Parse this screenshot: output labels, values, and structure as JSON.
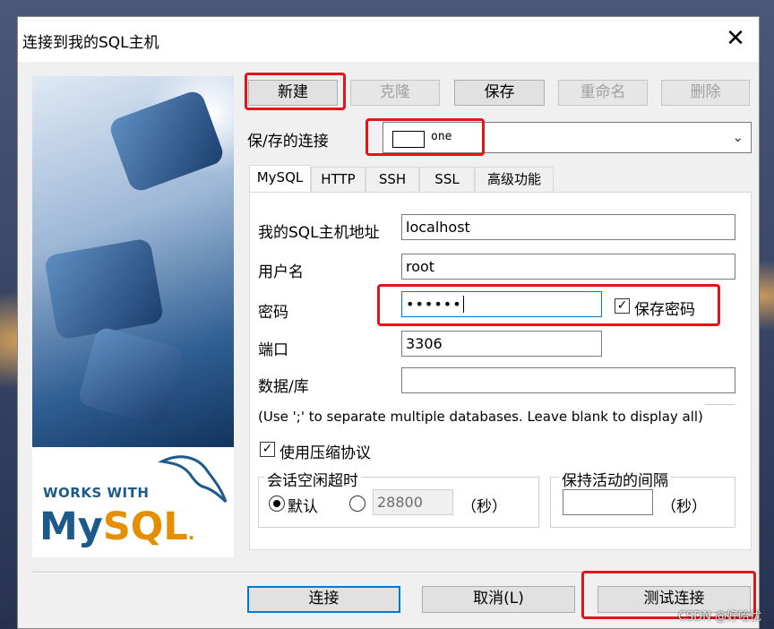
{
  "window": {
    "title": "连接到我的SQL主机",
    "close_label": "✕"
  },
  "toolbar": {
    "new_label": "新建",
    "clone_label": "克隆",
    "save_label": "保存",
    "rename_label": "重命名",
    "delete_label": "删除"
  },
  "saved_connections": {
    "label": "保/存的连接",
    "selected": "one",
    "swatch_color": "#ffffff"
  },
  "tabs": [
    "MySQL",
    "HTTP",
    "SSH",
    "SSL",
    "高级功能"
  ],
  "form": {
    "host_label": "我的SQL主机地址",
    "host_value": "localhost",
    "user_label": "用户名",
    "user_value": "root",
    "password_label": "密码",
    "password_value": "••••••",
    "save_password_label": "保存密码",
    "save_password_checked": true,
    "port_label": "端口",
    "port_value": "3306",
    "database_label": "数据/库",
    "database_value": "",
    "database_hint": "(Use ';' to separate multiple databases. Leave blank to display all)",
    "compress_label": "使用压缩协议",
    "compress_checked": true
  },
  "session_timeout": {
    "title": "会话空闲超时",
    "default_label": "默认",
    "default_selected": true,
    "custom_value": "28800",
    "unit_label": "（秒）"
  },
  "keepalive": {
    "title": "保持活动的间隔",
    "value": "",
    "unit_label": "（秒）"
  },
  "footer": {
    "connect_label": "连接",
    "cancel_label": "取消(L)",
    "test_label": "测试连接"
  },
  "branding": {
    "works_with": "WORKS WITH",
    "mysql_my": "My",
    "mysql_sql": "SQL",
    "mysql_dot": "."
  },
  "watermark": "CSDN @好哈忧",
  "colors": {
    "highlight_red": "#e3141a",
    "focus_blue": "#0078d7",
    "mysql_blue": "#1d5a8c",
    "mysql_orange": "#e48e00"
  }
}
